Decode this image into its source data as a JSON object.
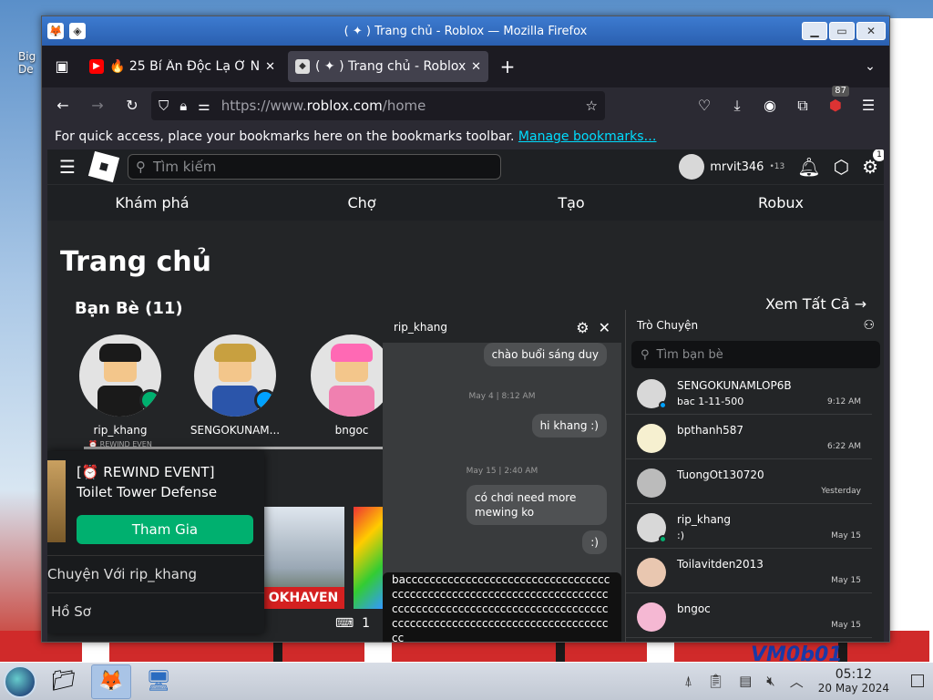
{
  "desktop": {
    "icon_label": "Big\nDe",
    "watermark": "VM0b01"
  },
  "window": {
    "title": "( ✦ ) Trang chủ - Roblox — Mozilla Firefox",
    "controls": [
      "▁",
      "▭",
      "✕"
    ]
  },
  "tabs": [
    {
      "label": "🔥 25 Bí Ẩn Độc Lạ Ở Nước",
      "close": "✕"
    },
    {
      "label": "( ✦ ) Trang chủ - Roblox",
      "close": "✕"
    }
  ],
  "new_tab": "+",
  "tab_list": "⌄",
  "url": {
    "prefix": "https://www.",
    "host": "roblox.com",
    "path": "/home"
  },
  "extension_badge": "87",
  "bookmarks_bar": {
    "text": "For quick access, place your bookmarks here on the bookmarks toolbar.",
    "link": "Manage bookmarks…"
  },
  "roblox": {
    "search_placeholder": "Tìm kiếm",
    "username": "mrvit346",
    "age_label": "•13",
    "settings_badge": "1",
    "nav": [
      "Khám phá",
      "Chợ",
      "Tạo",
      "Robux"
    ],
    "page_title": "Trang chủ",
    "friends_title": "Bạn Bè (11)",
    "see_all": "Xem Tất Cả →",
    "friends": [
      {
        "name": "rip_khang",
        "sub": "⏰ REWIND EVEN",
        "status_color": "#00b06f"
      },
      {
        "name": "SENGOKUNAM...",
        "sub": "",
        "status_color": "#00a2ff"
      },
      {
        "name": "bngoc",
        "sub": "",
        "status_color": ""
      }
    ],
    "game_popup": {
      "line1": "[⏰ REWIND EVENT]",
      "line2": "Toilet Tower Defense",
      "join": "Tham Gia",
      "chat": "Chuyện Với rip_khang",
      "profile": "Hồ Sơ"
    },
    "tile_caption": "OKHAVEN",
    "tile_meta": "1"
  },
  "conversation": {
    "title": "rip_khang",
    "messages": [
      {
        "text": "chào buổi sáng duy"
      },
      {
        "stamp": "May 4 | 8:12 AM"
      },
      {
        "text": "hi khang :)"
      },
      {
        "stamp": "May 15 | 2:40 AM"
      },
      {
        "text": "có chơi need more mewing ko"
      },
      {
        "text": ":)"
      }
    ],
    "draft": "bacccccccccccccccccccccccccccccccccccccccccccccccccccccccccccccccccccccccccccccccccccccccccccccccccccccccccccccccccccccccccccccccccccccccccccccccc"
  },
  "chat_list": {
    "title": "Trò Chuyện",
    "search_placeholder": "Tìm bạn bè",
    "rows": [
      {
        "name": "SENGOKUNAMLOP6B",
        "msg": "bac 1-11-500",
        "time": "9:12 AM",
        "online": "#00a2ff"
      },
      {
        "name": "bpthanh587",
        "msg": "",
        "time": "6:22 AM",
        "online": ""
      },
      {
        "name": "TuongOt130720",
        "msg": "",
        "time": "Yesterday",
        "online": ""
      },
      {
        "name": "rip_khang",
        "msg": ":)",
        "time": "May 15",
        "online": "#00b06f"
      },
      {
        "name": "Toilavitden2013",
        "msg": "",
        "time": "May 15",
        "online": ""
      },
      {
        "name": "bngoc",
        "msg": "",
        "time": "May 15",
        "online": ""
      }
    ]
  },
  "taskbar": {
    "time": "05:12",
    "date": "20 May 2024"
  }
}
